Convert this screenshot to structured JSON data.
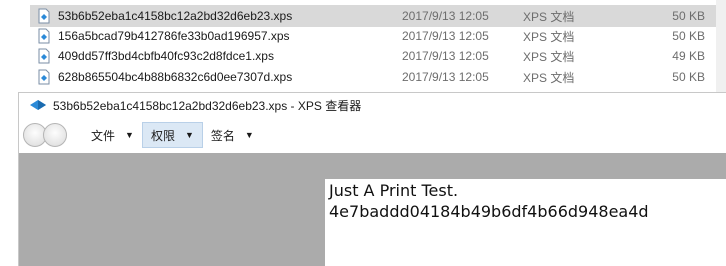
{
  "explorer": {
    "files": [
      {
        "name": "53b6b52eba1c4158bc12a2bd32d6eb23.xps",
        "date": "2017/9/13 12:05",
        "type": "XPS 文档",
        "size": "50 KB",
        "selected": true
      },
      {
        "name": "156a5bcad79b412786fe33b0ad196957.xps",
        "date": "2017/9/13 12:05",
        "type": "XPS 文档",
        "size": "50 KB",
        "selected": false
      },
      {
        "name": "409dd57ff3bd4cbfb40fc93c2d8fdce1.xps",
        "date": "2017/9/13 12:05",
        "type": "XPS 文档",
        "size": "49 KB",
        "selected": false
      },
      {
        "name": "628b865504bc4b88b6832c6d0ee7307d.xps",
        "date": "2017/9/13 12:05",
        "type": "XPS 文档",
        "size": "50 KB",
        "selected": false
      }
    ]
  },
  "viewer": {
    "title": "53b6b52eba1c4158bc12a2bd32d6eb23.xps - XPS 查看器",
    "menus": [
      {
        "label": "文件",
        "active": false
      },
      {
        "label": "权限",
        "active": true
      },
      {
        "label": "签名",
        "active": false
      }
    ],
    "document": {
      "lines": [
        "Just A Print Test.",
        "4e7baddd04184b49b6df4b66d948ea4d"
      ]
    }
  },
  "colors": {
    "selected_row": "#d9d9d9",
    "doc_background": "#ababab",
    "active_menu": "#dbe8f5"
  },
  "icons": {
    "file": "xps-file-icon",
    "app": "xps-viewer-icon",
    "back": "back-icon",
    "forward": "forward-icon",
    "dropdown": "chevron-down-icon"
  }
}
